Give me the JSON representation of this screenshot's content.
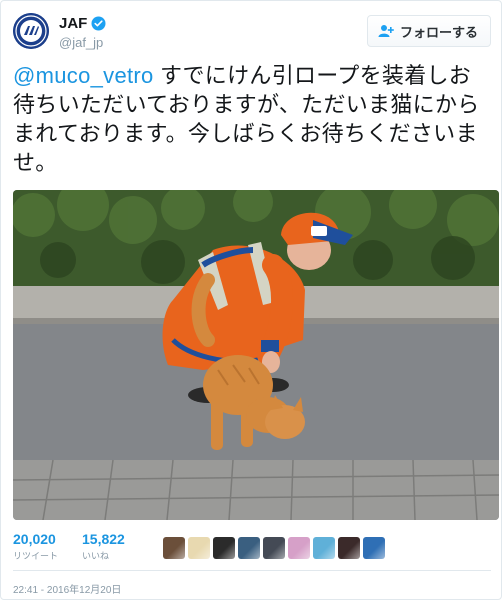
{
  "author": {
    "display_name": "JAF",
    "handle": "@jaf_jp",
    "verified": true,
    "brand_color": "#1c3f8c"
  },
  "follow_button": {
    "label": "フォローする",
    "icon": "add-user-icon"
  },
  "tweet": {
    "mention": "@muco_vetro",
    "text": " すでにけん引ロープを装着しお待ちいただいておりますが、ただいま猫にからまれております。今しばらくお待ちくださいませ。"
  },
  "stats": {
    "retweets": {
      "count": "20,020",
      "label": "リツイート"
    },
    "likes": {
      "count": "15,822",
      "label": "いいね"
    }
  },
  "likers": [
    {
      "color": "#6b4f3a"
    },
    {
      "color": "#e8d9b0"
    },
    {
      "color": "#2b2b2b"
    },
    {
      "color": "#3a5f80"
    },
    {
      "color": "#444a55"
    },
    {
      "color": "#d6a0c8"
    },
    {
      "color": "#5fb0d8"
    },
    {
      "color": "#3b2a2a"
    },
    {
      "color": "#2f6fb5"
    }
  ],
  "timestamp": "22:41 - 2016年12月20日",
  "colors": {
    "link": "#1b95e0",
    "muted": "#8899a6",
    "border": "#e1e8ed"
  }
}
